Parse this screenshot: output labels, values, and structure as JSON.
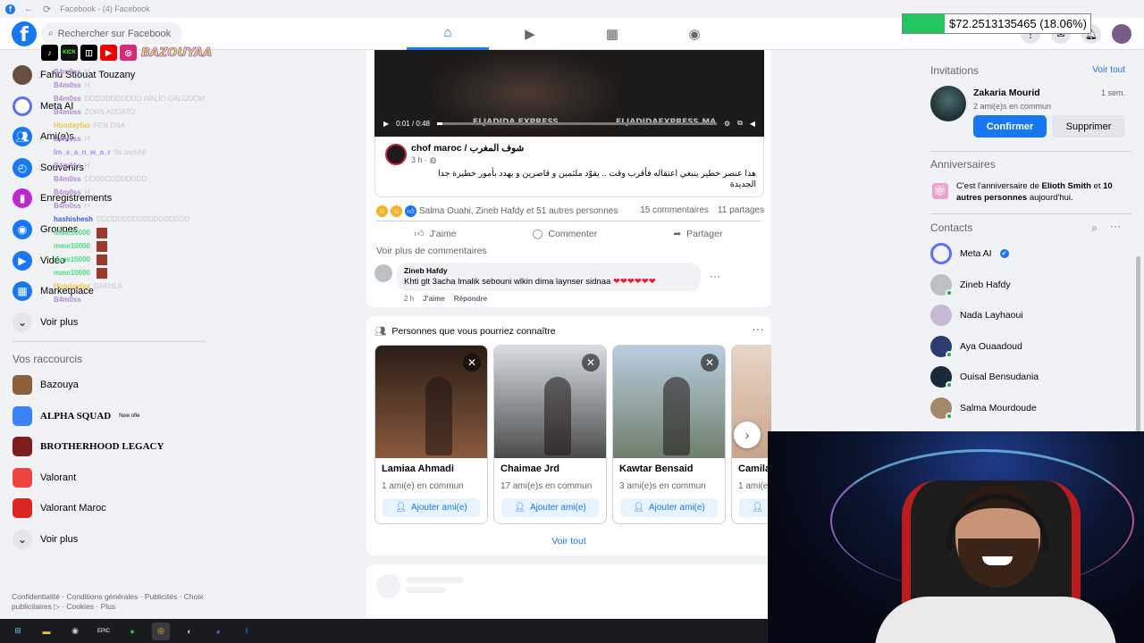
{
  "window": {
    "title": "Facebook - (4) Facebook"
  },
  "header": {
    "search_placeholder": "Rechercher sur Facebook",
    "tabs": [
      {
        "name": "home",
        "icon": "home-icon",
        "active": true
      },
      {
        "name": "watch",
        "icon": "video-icon",
        "active": false
      },
      {
        "name": "marketplace",
        "icon": "store-icon",
        "active": false
      },
      {
        "name": "groups",
        "icon": "groups-icon",
        "active": false
      }
    ]
  },
  "overlay": {
    "money_text": "$72.2513135465 (18.06%)",
    "money_progress": 0.1806,
    "social_handle": "BAZOUYAA",
    "social_icons": [
      "tiktok-icon",
      "kick-icon",
      "twitch-icon",
      "youtube-icon",
      "instagram-icon"
    ],
    "chat": [
      {
        "user": "B4m0ss",
        "msg": "H",
        "color": "#b48ad1"
      },
      {
        "user": "B4m0ss",
        "msg": "H",
        "color": "#b48ad1"
      },
      {
        "user": "B4m0ss",
        "msg": "DDDDDDDDDDD WALID GALGOOM",
        "color": "#b48ad1"
      },
      {
        "user": "B4m0ss",
        "msg": "ZORS ADDATO",
        "color": "#b48ad1"
      },
      {
        "user": "Hoodayfaa",
        "msg": "FEN DNA",
        "color": "#f5c542"
      },
      {
        "user": "B4m0ss",
        "msg": "H",
        "color": "#b48ad1"
      },
      {
        "user": "Im_s_a_n_w_a_r",
        "msg": "9a barkAll",
        "color": "#a78bfa"
      },
      {
        "user": "B4m0ss",
        "msg": "H",
        "color": "#b48ad1"
      },
      {
        "user": "B4m0ss",
        "msg": "DDDDDDDDDDDD",
        "color": "#b48ad1"
      },
      {
        "user": "B4m0ss",
        "msg": "H",
        "color": "#b48ad1"
      },
      {
        "user": "B4m0ss",
        "msg": "H",
        "color": "#b48ad1"
      },
      {
        "user": "hashishesh",
        "msg": "DDDDDDDDDDDDDDDDDD",
        "color": "#3b5ed7"
      },
      {
        "user": "mme10000",
        "msg": "",
        "color": "#4ade80"
      },
      {
        "user": "mme10000",
        "msg": "",
        "color": "#4ade80"
      },
      {
        "user": "mme10000",
        "msg": "",
        "color": "#4ade80"
      },
      {
        "user": "mme10000",
        "msg": "",
        "color": "#4ade80"
      },
      {
        "user": "Hoodayfaa",
        "msg": "DAKHLA",
        "color": "#f5c542"
      },
      {
        "user": "B4m0ss",
        "msg": "",
        "color": "#b48ad1"
      }
    ]
  },
  "left_nav": {
    "items": [
      {
        "label": "Fahd Stiouat Touzany",
        "icon": "avatar-icon",
        "color": "#6b4e3d"
      },
      {
        "label": "Meta AI",
        "icon": "meta-ai-icon",
        "color": "#ffffff"
      },
      {
        "label": "Ami(e)s",
        "icon": "friends-icon",
        "color": "#1877f2"
      },
      {
        "label": "Souvenirs",
        "icon": "clock-icon",
        "color": "#1877f2"
      },
      {
        "label": "Enregistrements",
        "icon": "bookmark-icon",
        "color": "#c026d3"
      },
      {
        "label": "Groupes",
        "icon": "groups-icon",
        "color": "#1877f2"
      },
      {
        "label": "Vidéo",
        "icon": "video-icon",
        "color": "#1877f2"
      },
      {
        "label": "Marketplace",
        "icon": "store-icon",
        "color": "#1877f2"
      }
    ],
    "see_more": "Voir plus",
    "shortcuts_title": "Vos raccourcis",
    "shortcuts": [
      {
        "label": "Bazouya",
        "color": "#8b5e3c"
      },
      {
        "label": "ALPHA SQUAD",
        "badge": "New ofle",
        "color": "#3b82f6"
      },
      {
        "label": "BROTHERHOOD LEGACY",
        "color": "#7f1d1d"
      },
      {
        "label": "Valorant",
        "color": "#ef4444"
      },
      {
        "label": "Valorant Maroc",
        "color": "#dc2626"
      }
    ],
    "see_more_2": "Voir plus",
    "footer": "Confidentialité · Conditions générales · Publicités · Choix publicitaires ▷ · Cookies · Plus"
  },
  "post": {
    "video_time": "0:01 / 0:48",
    "video_progress": 0.02,
    "watermark_1": "ELJADIDA EXPRESS",
    "watermark_2": "ELJADIDAEXPRESS.MA",
    "shared_page": "chof maroc / شوف المغرب",
    "shared_time": "3 h ·",
    "shared_text": "هذا عنصر خطير ينبغي اعتقاله فأقرب وقت .. يقوّد ملثمين و قاصرين و يهدد بأمور خطيرة جدا الجديدة",
    "reactions_names": "Salma Ouahi, Zineb Hafdy et 51 autres personnes",
    "comments_count": "15 commentaires",
    "shares_count": "11 partages",
    "action_like": "J'aime",
    "action_comment": "Commenter",
    "action_share": "Partager",
    "see_more_comments": "Voir plus de commentaires",
    "comment": {
      "author": "Zineb Hafdy",
      "text": "Khti glt 3acha lmalik sebouni wlkin dima laynser sidnaa",
      "hearts": "❤❤❤❤❤❤",
      "time": "2 h",
      "like": "J'aime",
      "reply": "Répondre"
    }
  },
  "pymk": {
    "title": "Personnes que vous pourriez connaître",
    "add_label": "Ajouter ami(e)",
    "see_all": "Voir tout",
    "people": [
      {
        "name": "Lamiaa Ahmadi",
        "mutual": "1 ami(e) en commun",
        "img_top": "#2a1d16",
        "img_bottom": "#8a5a3c"
      },
      {
        "name": "Chaimae Jrd",
        "mutual": "17 ami(e)s en commun",
        "img_top": "#d6dde3",
        "img_bottom": "#4b4b4b"
      },
      {
        "name": "Kawtar Bensaid",
        "mutual": "3 ami(e)s en commun",
        "img_top": "#b9cde0",
        "img_bottom": "#6f7f6a"
      },
      {
        "name": "Camila",
        "mutual": "1 ami(e",
        "img_top": "#e8d6c8",
        "img_bottom": "#c9a48a"
      }
    ]
  },
  "right": {
    "invitations_title": "Invitations",
    "invitations_link": "Voir tout",
    "invite": {
      "name": "Zakaria Mourid",
      "time": "1 sem.",
      "mutual": "2 ami(e)s en commun",
      "confirm": "Confirmer",
      "delete": "Supprimer"
    },
    "birthdays_title": "Anniversaires",
    "birthday_pre": "C'est l'anniversaire de ",
    "birthday_name": "Elioth Smith",
    "birthday_mid": " et ",
    "birthday_count": "10 autres personnes",
    "birthday_post": " aujourd'hui.",
    "contacts_title": "Contacts",
    "contacts": [
      {
        "name": "Meta AI",
        "verified": true,
        "online": false,
        "color": "#ffffff"
      },
      {
        "name": "Zineb Hafdy",
        "verified": false,
        "online": true,
        "color": "#bcc0c4"
      },
      {
        "name": "Nada Layhaoui",
        "verified": false,
        "online": false,
        "color": "#c7b9d6"
      },
      {
        "name": "Aya Ouaadoud",
        "verified": false,
        "online": true,
        "color": "#2c3e70"
      },
      {
        "name": "Ouisal Bensudania",
        "verified": false,
        "online": true,
        "color": "#1a2a3a"
      },
      {
        "name": "Salma Mourdoude",
        "verified": false,
        "online": true,
        "color": "#a38a6b"
      }
    ]
  },
  "taskbar": {
    "apps": [
      "windows-icon",
      "explorer-icon",
      "steam-icon",
      "epic-icon",
      "spotify-icon",
      "chrome-icon",
      "obs-icon",
      "discord-icon",
      "facebook-icon"
    ]
  }
}
